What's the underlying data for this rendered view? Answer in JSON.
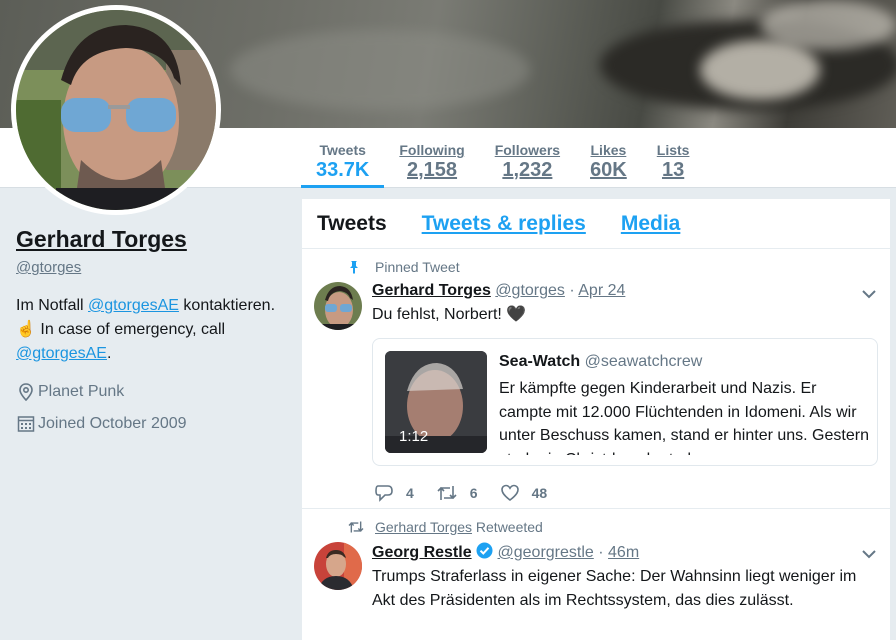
{
  "profile": {
    "name": "Gerhard Torges",
    "handle": "@gtorges",
    "bio_part1": "Im Notfall ",
    "bio_link1": "@gtorgesAE",
    "bio_part2": " kontaktieren. ☝️ In case of emergency, call ",
    "bio_link2": "@gtorgesAE",
    "bio_part3": ".",
    "location": "Planet Punk",
    "joined": "Joined October 2009"
  },
  "nav": {
    "stats": [
      {
        "label": "Tweets",
        "value": "33.7K"
      },
      {
        "label": "Following",
        "value": "2,158"
      },
      {
        "label": "Followers",
        "value": "1,232"
      },
      {
        "label": "Likes",
        "value": "60K"
      },
      {
        "label": "Lists",
        "value": "13"
      }
    ]
  },
  "timeline": {
    "tabs": [
      "Tweets",
      "Tweets & replies",
      "Media"
    ],
    "tweet1": {
      "context": "Pinned Tweet",
      "name": "Gerhard Torges",
      "handle": "@gtorges",
      "dot": "·",
      "date": "Apr 24",
      "text": "Du fehlst, Norbert! 🖤",
      "card": {
        "name": "Sea-Watch",
        "handle": "@seawatchcrew",
        "duration": "1:12",
        "text": "Er kämpfte gegen Kinderarbeit und Nazis. Er campte mit 12.000 Flüchtenden in Idomeni. Als wir unter Beschuss kamen, stand er hinter uns. Gestern starb ein Christdemokrat, dessen"
      },
      "replies": "4",
      "retweets": "6",
      "likes": "48"
    },
    "tweet2": {
      "context_name": "Gerhard Torges",
      "context_suffix": " Retweeted",
      "name": "Georg Restle",
      "handle": "@georgrestle",
      "dot": "·",
      "date": "46m",
      "text": "Trumps Straferlass in eigener Sache:  Der Wahnsinn liegt weniger im Akt des Präsidenten als im Rechtssystem, das dies zulässt."
    }
  },
  "colors": {
    "accent": "#1da1f2",
    "link": "#1b95e0",
    "secondary_text": "#657786",
    "background": "#e6ecf0"
  }
}
